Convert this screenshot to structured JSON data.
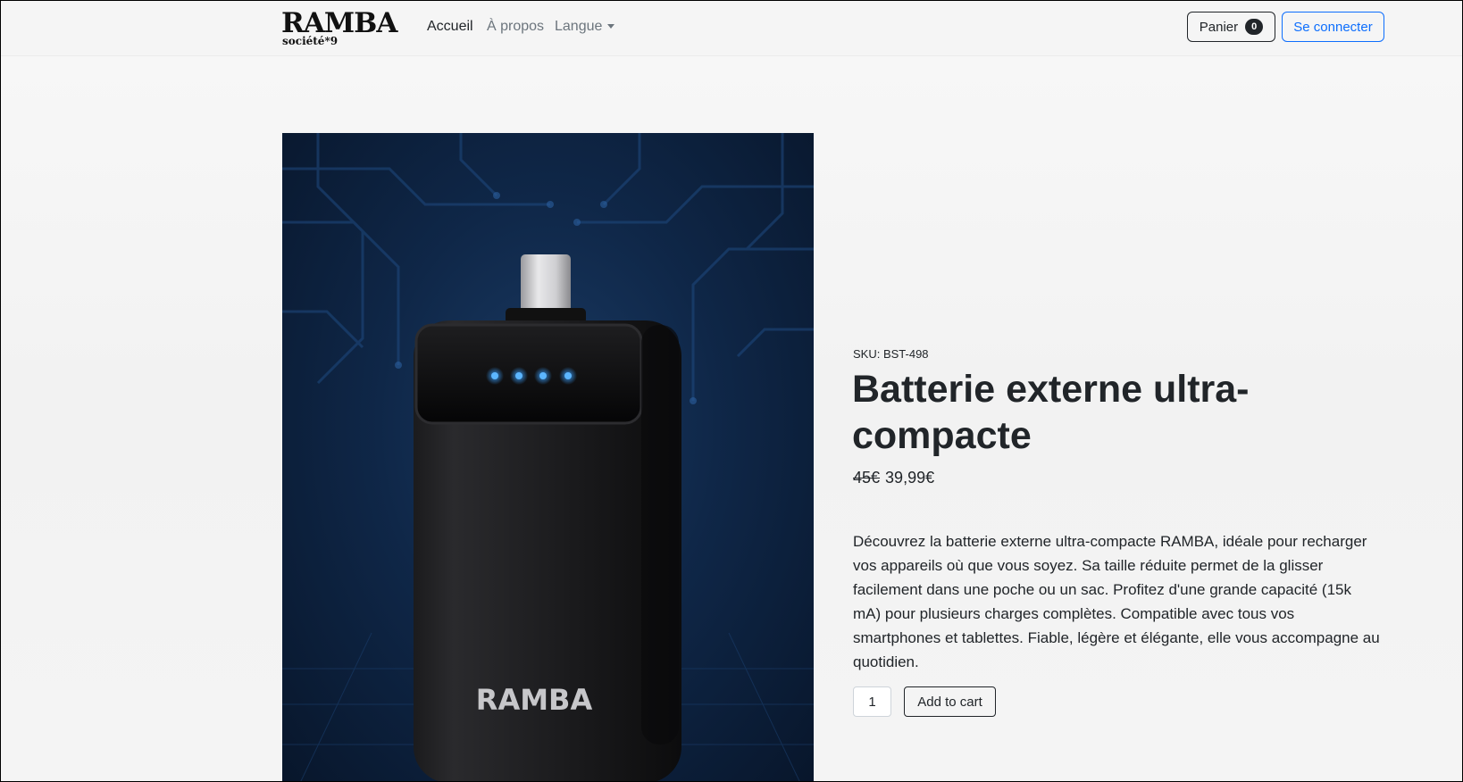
{
  "navbar": {
    "brand": {
      "name": "RAMBA",
      "tagline": "société*9"
    },
    "links": [
      {
        "label": "Accueil",
        "active": true
      },
      {
        "label": "À propos",
        "active": false
      },
      {
        "label": "Langue",
        "active": false,
        "dropdown": true
      }
    ],
    "cart": {
      "label": "Panier",
      "count": "0"
    },
    "login": {
      "label": "Se connecter"
    }
  },
  "product": {
    "image_brand_text": "RAMBA",
    "sku": "SKU: BST-498",
    "title": "Batterie externe ultra-compacte",
    "old_price": "45€",
    "price": "39,99€",
    "description": "Découvrez la batterie externe ultra-compacte RAMBA, idéale pour recharger vos appareils où que vous soyez. Sa taille réduite permet de la glisser facilement dans une poche ou un sac. Profitez d'une grande capacité (15k mA) pour plusieurs charges complètes. Compatible avec tous vos smartphones et tablettes. Fiable, légère et élégante, elle vous accompagne au quotidien.",
    "quantity": "1",
    "add_to_cart_label": "Add to cart"
  },
  "colors": {
    "primary": "#0d6efd",
    "dark": "#212529",
    "muted": "#6c757d",
    "led": "#3aa0ff"
  },
  "icons": {
    "dropdown": "chevron-down-icon"
  }
}
